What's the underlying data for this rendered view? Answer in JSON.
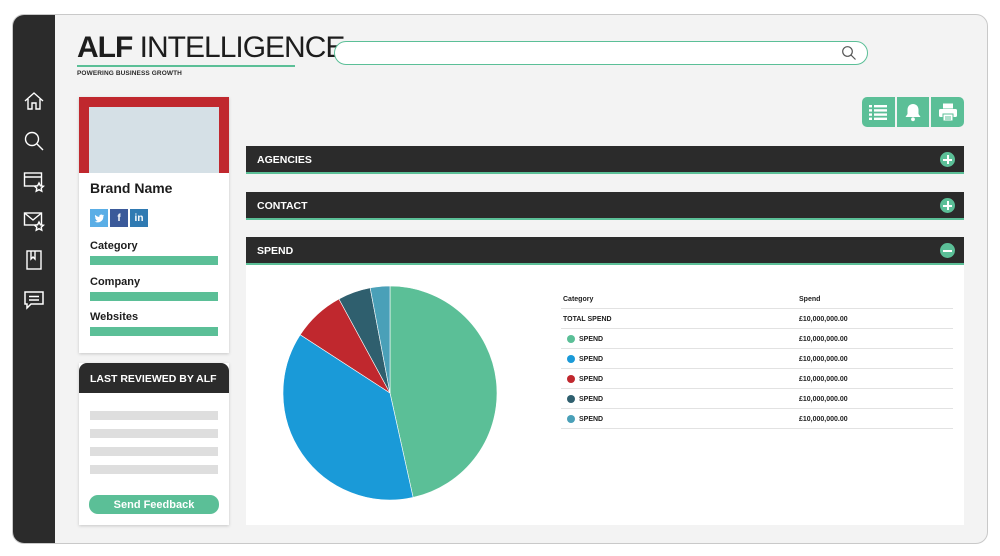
{
  "logo": {
    "bold": "ALF",
    "light": "INTELLIGENCE",
    "tagline": "POWERING BUSINESS GROWTH"
  },
  "search": {
    "value": "",
    "placeholder": ""
  },
  "nav_icons": [
    "home-icon",
    "search-icon",
    "starred-window-icon",
    "starred-mail-icon",
    "bookmark-icon",
    "chat-icon"
  ],
  "brand": {
    "name": "Brand Name",
    "socials": [
      {
        "icon": "twitter-icon"
      },
      {
        "label": "f",
        "icon": "facebook-icon"
      },
      {
        "label": "in",
        "icon": "linkedin-icon"
      }
    ],
    "fields": [
      "Category",
      "Company",
      "Websites"
    ]
  },
  "review": {
    "title": "LAST REVIEWED BY ALF",
    "feedback_label": "Send Feedback"
  },
  "toolbar": [
    "list-icon",
    "bell-icon",
    "print-icon"
  ],
  "sections": [
    {
      "title": "AGENCIES",
      "state": "collapsed"
    },
    {
      "title": "CONTACT",
      "state": "collapsed"
    },
    {
      "title": "SPEND",
      "state": "expanded"
    }
  ],
  "spend": {
    "headers": {
      "category": "Category",
      "spend": "Spend"
    },
    "total": {
      "label": "TOTAL SPEND",
      "value": "£10,000,000.00"
    },
    "rows": [
      {
        "label": "SPEND",
        "value": "£10,000,000.00",
        "color": "#5bbf97"
      },
      {
        "label": "SPEND",
        "value": "£10,000,000.00",
        "color": "#1a9ad8"
      },
      {
        "label": "SPEND",
        "value": "£10,000,000.00",
        "color": "#c0282e"
      },
      {
        "label": "SPEND",
        "value": "£10,000,000.00",
        "color": "#2f5f6e"
      },
      {
        "label": "SPEND",
        "value": "£10,000,000.00",
        "color": "#4aa0b8"
      }
    ]
  },
  "chart_data": {
    "type": "pie",
    "values": [
      47,
      38,
      8,
      5,
      3
    ],
    "colors": [
      "#5bbf97",
      "#1a9ad8",
      "#c0282e",
      "#2f5f6e",
      "#4aa0b8"
    ]
  },
  "colors": {
    "accent": "#5bbf97",
    "dark": "#2b2b2b",
    "brand_red": "#c0282e"
  }
}
